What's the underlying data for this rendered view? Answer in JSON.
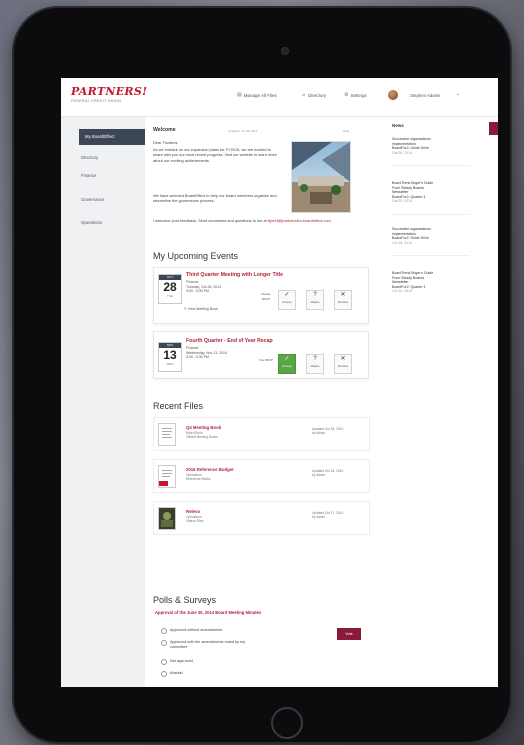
{
  "header": {
    "logo_text": "PARTNERS!",
    "logo_subtitle": "FEDERAL CREDIT UNION",
    "nav": [
      {
        "icon": "document-icon",
        "label": "Manage All Files"
      },
      {
        "icon": "people-icon",
        "label": "Directory"
      },
      {
        "icon": "gear-icon",
        "label": "Settings"
      }
    ],
    "user_name": "Stephen Adams",
    "user_menu_chevron": "⌄"
  },
  "sidebar": {
    "active_item": "My BoardEffect",
    "items": [
      "Directory",
      "Finance",
      "Governance",
      "Operations"
    ]
  },
  "welcome": {
    "title": "Welcome",
    "meta_left": "Updated: Jul 18, 2014",
    "meta_right": "Hide",
    "greeting": "Dear Trustees",
    "paragraph1": "As we embark on our expansion plans for FY2015, we are excited to share with you our most recent progress. Visit our website to learn more about our exciting achievements.",
    "paragraph2": "We have selected BoardEffect to help our board members organize and streamline the governance process.",
    "feedback_text": "I welcome your feedback. Send comments and questions to me at",
    "feedback_email": "ttyrrell@partnersfcu.boardeffect.com"
  },
  "events": {
    "heading": "My Upcoming Events",
    "items": [
      {
        "month": "OCT",
        "day": "28",
        "weekday": "TUE",
        "title": "Third Quarter Meeting with Longer Title",
        "location": "Finance",
        "date": "Tuesday, Oct 28, 2014",
        "time": "3:00 - 5:30 PM",
        "book": "View Meeting Book",
        "rsvp_status": "Please RSVP",
        "rsvp": [
          "Accept",
          "Maybe",
          "Decline"
        ]
      },
      {
        "month": "NOV",
        "day": "13",
        "weekday": "WED",
        "title": "Fourth Quarter - End of Year Recap",
        "location": "Finance",
        "date": "Wednesday, Nov 13, 2014",
        "time": "3:00 - 5:30 PM",
        "rsvp_status": "You RSVP",
        "rsvp": [
          "Accept",
          "Maybe",
          "Decline"
        ]
      }
    ]
  },
  "files": {
    "heading": "Recent Files",
    "items": [
      {
        "name": "Q4 Meeting Book",
        "meta1": "Board Book",
        "meta2": "Official Meeting Books",
        "date1": "Updated Oct 28, 2014",
        "date2": "by Admin"
      },
      {
        "name": "2015 Reference Budget",
        "meta1": "Operations",
        "meta2": "Reference Books",
        "date1": "Updated Oct 18, 2014",
        "date2": "by Admin"
      },
      {
        "name": "Relevo",
        "meta1": "Operations",
        "meta2": "Videos Files",
        "date1": "Updated Oct 17, 2014",
        "date2": "by Admin"
      }
    ]
  },
  "polls": {
    "heading": "Polls & Surveys",
    "question": "Approval of the June 30, 2014 Board Meeting Minutes",
    "options": [
      "Approved without amendments",
      "Approved with the amendments noted by my committee",
      "Not approved",
      "Abstain"
    ],
    "vote_label": "Vote"
  },
  "news": {
    "title": "News",
    "items": [
      {
        "l1": "Successful organizations",
        "l2": "implementation",
        "l3": "BoardFor2: Guide Drive",
        "d": "Oct 28, 2014"
      },
      {
        "l1": "BoardTrend Buyer's Guide",
        "l2": "From Steady Boards",
        "l3": "Newsletter",
        "l4": "BoardFor2: Quarter 4",
        "d": "Oct 20, 2014"
      },
      {
        "l1": "Successful organizations",
        "l2": "implementation",
        "l3": "BoardFor2: Guide Drive",
        "d": "Oct 18, 2014"
      },
      {
        "l1": "BoardTrend Buyer's Guide",
        "l2": "From Steady Boards",
        "l3": "Newsletter",
        "l4": "BoardFor2: Quarter 4",
        "d": "Oct 10, 2014"
      }
    ]
  },
  "colors": {
    "brand_red": "#c0182c",
    "accent_maroon": "#8b1a3a",
    "sidebar_active": "#3c4657",
    "accept_green": "#5aa545"
  }
}
